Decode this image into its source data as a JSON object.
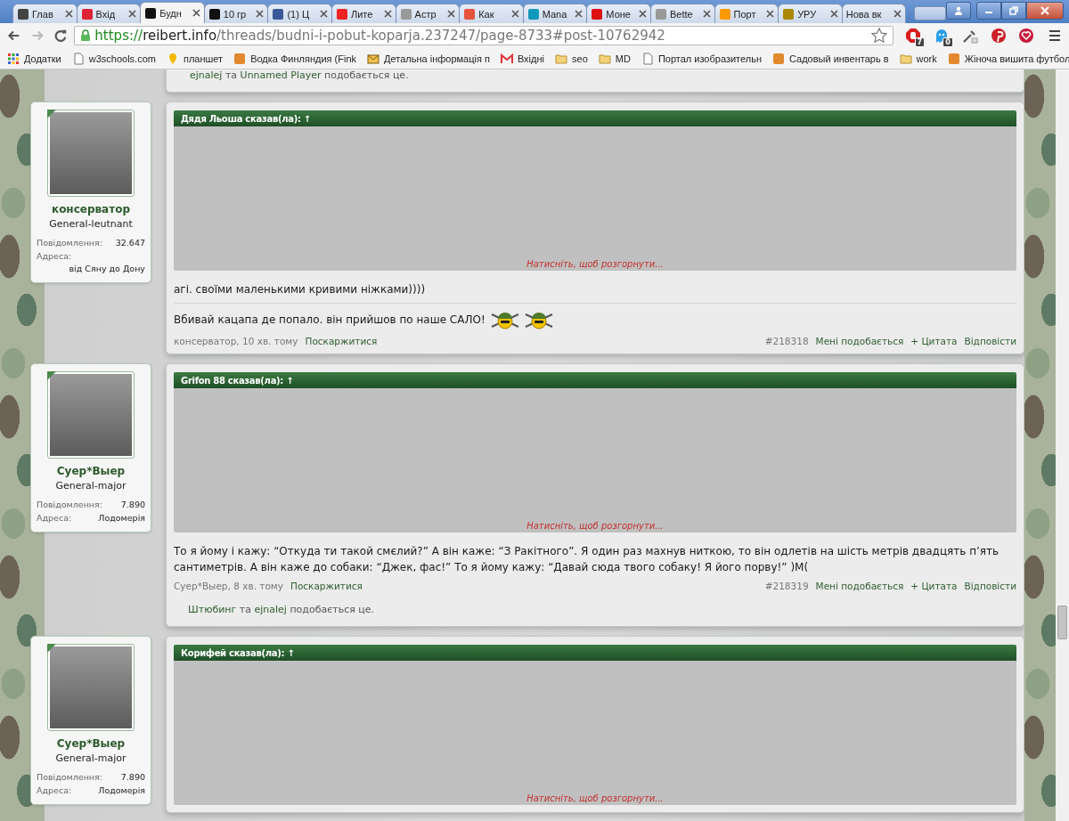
{
  "tabs": [
    {
      "label": "Глав",
      "selected": false
    },
    {
      "label": "Вхід",
      "selected": false
    },
    {
      "label": "Будн",
      "selected": true
    },
    {
      "label": "10 гр",
      "selected": false
    },
    {
      "label": "(1) Ц",
      "selected": false
    },
    {
      "label": "Лите",
      "selected": false
    },
    {
      "label": "Астр",
      "selected": false
    },
    {
      "label": "Как",
      "selected": false
    },
    {
      "label": "Mana",
      "selected": false
    },
    {
      "label": "Моне",
      "selected": false
    },
    {
      "label": "Bette",
      "selected": false
    },
    {
      "label": "Порт",
      "selected": false
    },
    {
      "label": "УРУ",
      "selected": false
    },
    {
      "label": "Нова вк",
      "selected": false
    }
  ],
  "address_bar": {
    "scheme": "https://",
    "host": "reibert.info",
    "path": "/threads/budni-i-pobut-koparja.237247/page-8733#post-10762942"
  },
  "extension_badges": [
    "7",
    "0"
  ],
  "bookmarks": [
    {
      "label": "Додатки",
      "kind": "apps"
    },
    {
      "label": "w3schools.com",
      "kind": "page"
    },
    {
      "label": "планшет",
      "kind": "pin"
    },
    {
      "label": "Водка Финляндия (Fink",
      "kind": "site"
    },
    {
      "label": "Детальна інформація п",
      "kind": "letter"
    },
    {
      "label": "Вхідні",
      "kind": "mail"
    },
    {
      "label": "seo",
      "kind": "folder"
    },
    {
      "label": "MD",
      "kind": "folder"
    },
    {
      "label": "Портал изобразительн",
      "kind": "page"
    },
    {
      "label": "Садовый инвентарь в",
      "kind": "site"
    },
    {
      "label": "work",
      "kind": "folder"
    },
    {
      "label": "Жіноча вишита футбол",
      "kind": "site"
    }
  ],
  "previous_post": {
    "likes": {
      "names": [
        "ejnalej",
        "Unnamed Player"
      ],
      "joiner": "та",
      "suffix": "подобається це."
    }
  },
  "posts": [
    {
      "user": {
        "name": "консерватор",
        "rank": "General-leutnant",
        "stats": [
          {
            "label": "Повідомлення:",
            "value": "32.647"
          },
          {
            "label": "Адреса:",
            "value": "від Сяну до Дону"
          }
        ]
      },
      "quote": {
        "header": "Дядя Льоша сказав(ла):",
        "arrow": "↑",
        "expand": "Натисніть, щоб розгорнути..."
      },
      "message": "агі. своїми маленькими кривими ніжками))))",
      "signature": {
        "text": "Вбивай кацапа де попало. він прийшов по наше САЛО!",
        "smilies": true
      },
      "footer": {
        "author_time": "консерватор, 10 хв. тому",
        "report": "Поскаржитися",
        "number": "#218318",
        "like": "Мені подобається",
        "quote": "+ Цитата",
        "reply": "Відповісти"
      }
    },
    {
      "user": {
        "name": "Суер*Выер",
        "rank": "General-major",
        "stats": [
          {
            "label": "Повідомлення:",
            "value": "7.890"
          },
          {
            "label": "Адреса:",
            "value": "Лодомерія"
          }
        ]
      },
      "quote": {
        "header": "Grifon 88 сказав(ла):",
        "arrow": "↑",
        "expand": "Натисніть, щоб розгорнути..."
      },
      "message": "То я йому і кажу: “Откуда ти такой смєлий?” А він каже: “З Ракітного”. Я один раз махнув ниткою, то він одлетів на шість метрів двадцять п’ять сантиметрів. А він каже до собаки: “Джек, фас!” То я йому кажу: “Давай сюда твого собаку! Я його порву!” )М(",
      "footer": {
        "author_time": "Суер*Выер, 8 хв. тому",
        "report": "Поскаржитися",
        "number": "#218319",
        "like": "Мені подобається",
        "quote": "+ Цитата",
        "reply": "Відповісти"
      },
      "likes": {
        "names": [
          "Штюбинг",
          "ejnalej"
        ],
        "joiner": "та",
        "suffix": "подобається це."
      }
    },
    {
      "user": {
        "name": "Суер*Выер",
        "rank": "General-major",
        "stats": [
          {
            "label": "Повідомлення:",
            "value": "7.890"
          },
          {
            "label": "Адреса:",
            "value": "Лодомерія"
          }
        ]
      },
      "quote": {
        "header": "Корифей сказав(ла):",
        "arrow": "↑",
        "expand": "Натисніть, щоб розгорнути..."
      }
    }
  ]
}
